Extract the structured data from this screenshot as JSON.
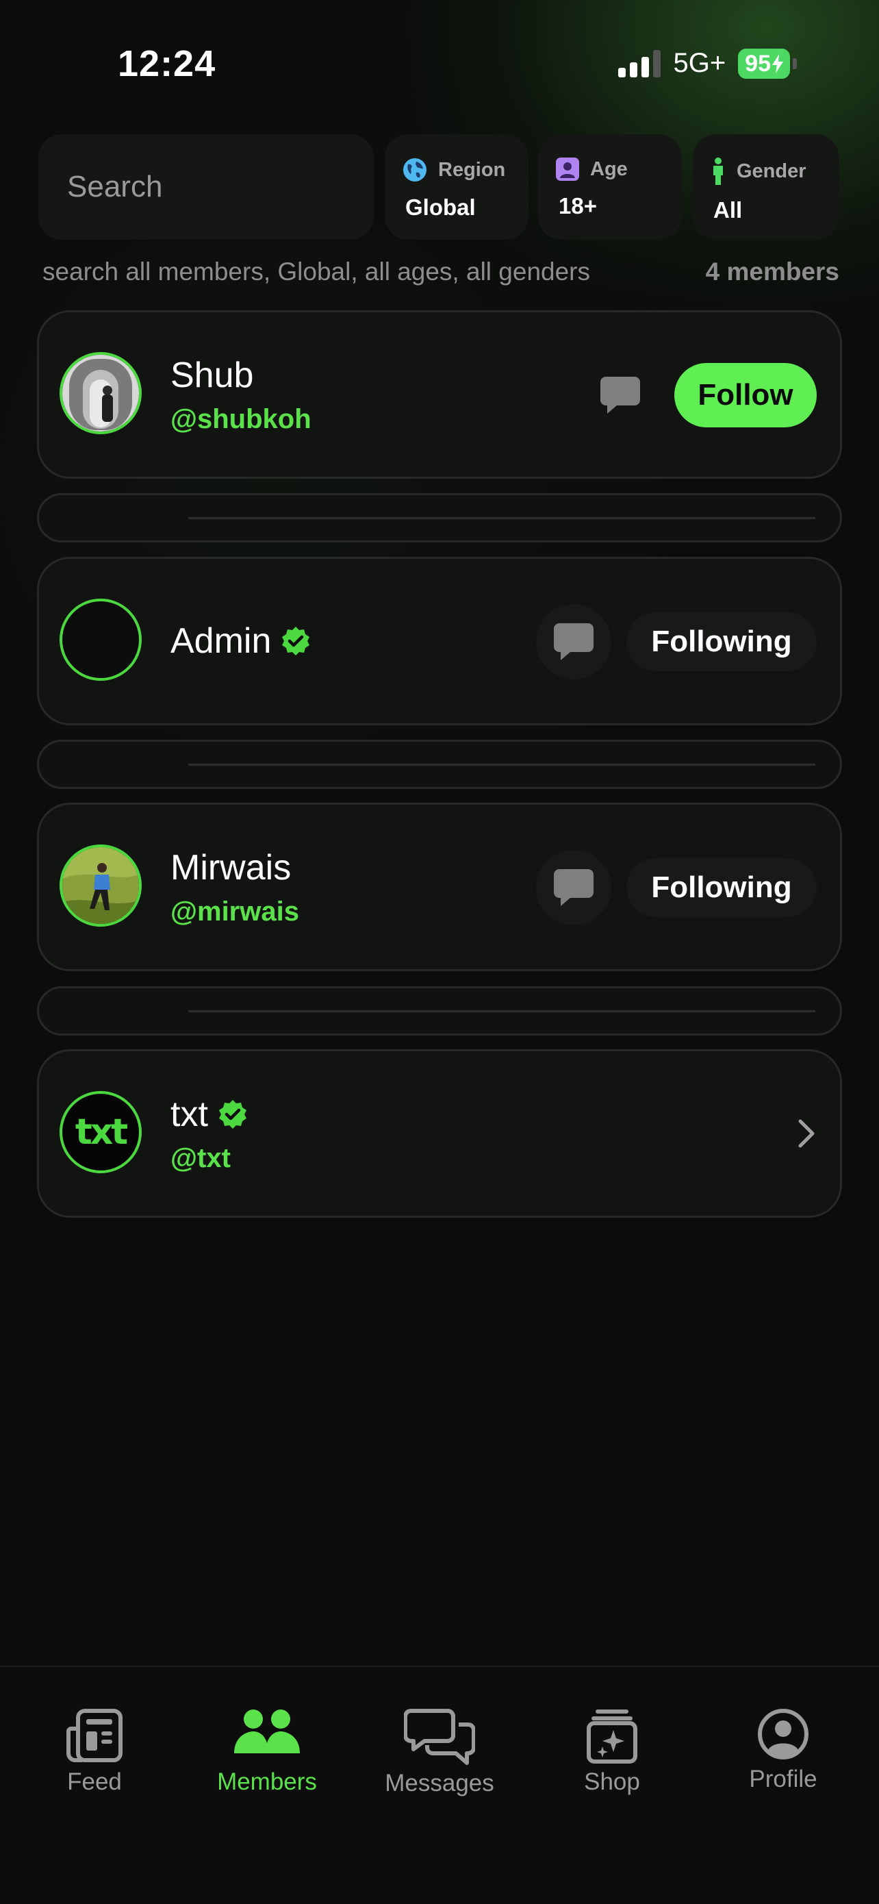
{
  "status_bar": {
    "time": "12:24",
    "network": "5G+",
    "battery": "95"
  },
  "search": {
    "placeholder": "Search"
  },
  "filters": [
    {
      "label": "Region",
      "value": "Global",
      "icon": "globe-icon"
    },
    {
      "label": "Age",
      "value": "18+",
      "icon": "person-card-icon"
    },
    {
      "label": "Gender",
      "value": "All",
      "icon": "person-icon"
    }
  ],
  "summary": {
    "text": "search all members, Global, all ages, all genders",
    "count": "4 members"
  },
  "members": [
    {
      "name": "Shub",
      "handle": "@shubkoh",
      "verified": false,
      "action": "Follow"
    },
    {
      "name": "Admin",
      "handle": "",
      "verified": true,
      "action": "Following"
    },
    {
      "name": "Mirwais",
      "handle": "@mirwais",
      "verified": false,
      "action": "Following"
    },
    {
      "name": "txt",
      "handle": "@txt",
      "verified": true,
      "action": "",
      "avatar_text": "txt"
    }
  ],
  "tabs": [
    {
      "label": "Feed",
      "icon": "newspaper-icon"
    },
    {
      "label": "Members",
      "icon": "people-icon",
      "active": true
    },
    {
      "label": "Messages",
      "icon": "chat-bubbles-icon"
    },
    {
      "label": "Shop",
      "icon": "shop-sparkle-icon"
    },
    {
      "label": "Profile",
      "icon": "profile-circle-icon"
    }
  ],
  "colors": {
    "accent": "#5fef52",
    "background": "#0b0c0b",
    "card": "#121412"
  }
}
